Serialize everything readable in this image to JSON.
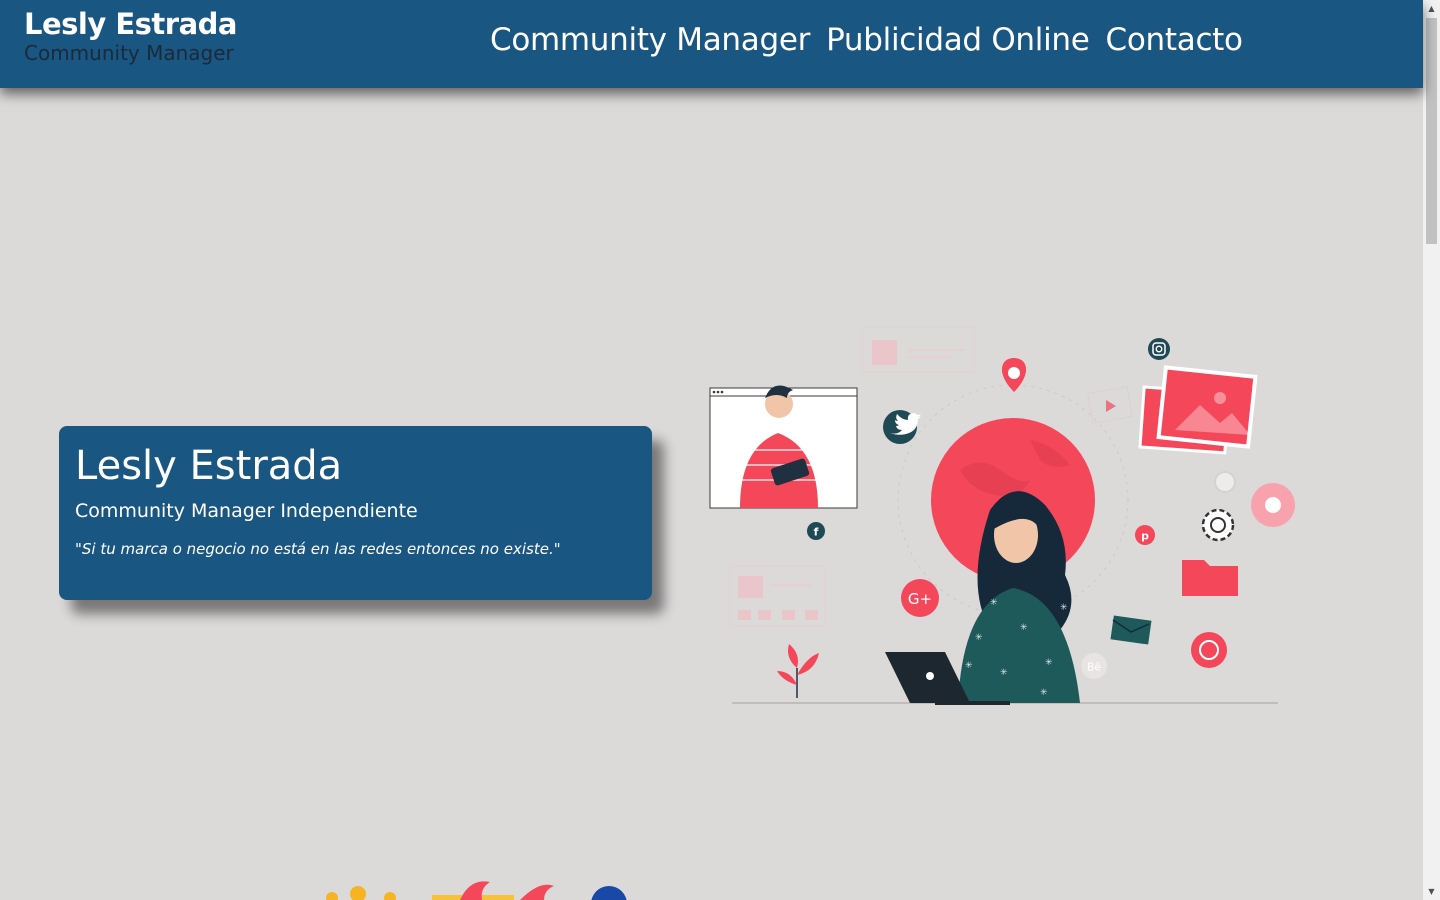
{
  "header": {
    "brand_name": "Lesly Estrada",
    "brand_tagline": "Community Manager",
    "nav": [
      {
        "label": "Community Manager"
      },
      {
        "label": "Publicidad Online"
      },
      {
        "label": "Contacto"
      }
    ],
    "background_color": "#1a5682"
  },
  "hero": {
    "title": "Lesly Estrada",
    "subtitle": "Community Manager Independiente",
    "quote": "\"Si tu marca o negocio no está en las redes entonces no existe.\""
  },
  "illustration": {
    "badges": [
      "twitter-icon",
      "instagram-icon",
      "facebook-icon",
      "pinterest-icon",
      "google-plus-icon",
      "whatsapp-icon",
      "behance-icon"
    ],
    "behance_label": "Bē",
    "google_label": "G+"
  },
  "colors": {
    "page_bg": "#dcd9d9",
    "brand_blue": "#1a5682",
    "accent_red": "#f4475a",
    "dark_teal": "#1f4a55"
  }
}
